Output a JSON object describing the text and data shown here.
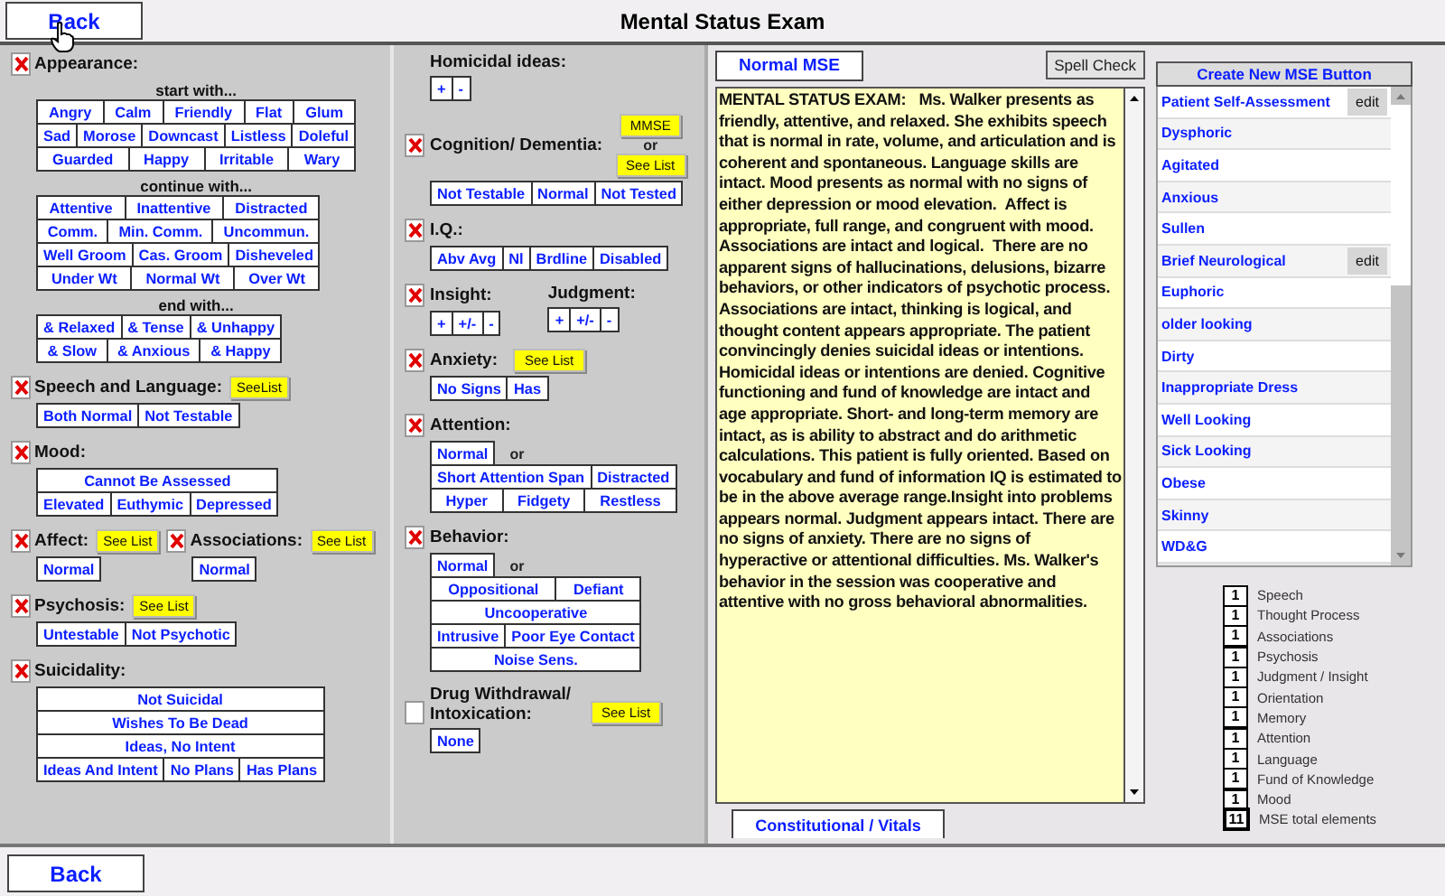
{
  "header": {
    "back": "Back",
    "title": "Mental Status Exam"
  },
  "columns": [
    {
      "sections": [
        {
          "parts": [
            {
              "label": "Appearance:",
              "checked": true,
              "groups": [
                {
                  "caption": "start with...",
                  "rows": [
                    {
                      "buttons": [
                        "Angry",
                        "Calm",
                        "Friendly",
                        "Flat",
                        "Glum"
                      ]
                    },
                    {
                      "buttons": [
                        "Sad",
                        "Morose",
                        "Downcast",
                        "Listless",
                        "Doleful"
                      ]
                    },
                    {
                      "buttons": [
                        "Guarded",
                        "Happy",
                        "Irritable",
                        "Wary"
                      ]
                    }
                  ]
                },
                {
                  "caption": "continue with...",
                  "rows": [
                    {
                      "buttons": [
                        "Attentive",
                        "Inattentive",
                        "Distracted"
                      ]
                    },
                    {
                      "buttons": [
                        "Comm.",
                        "Min. Comm.",
                        "Uncommun."
                      ]
                    },
                    {
                      "buttons": [
                        "Well Groom",
                        "Cas. Groom",
                        "Disheveled"
                      ]
                    },
                    {
                      "buttons": [
                        "Under Wt",
                        "Normal Wt",
                        "Over Wt"
                      ]
                    }
                  ]
                },
                {
                  "caption": "end with...",
                  "rows": [
                    {
                      "buttons": [
                        "& Relaxed",
                        "& Tense",
                        "& Unhappy"
                      ]
                    },
                    {
                      "buttons": [
                        "& Slow",
                        "& Anxious",
                        "& Happy"
                      ]
                    }
                  ]
                }
              ]
            }
          ]
        },
        {
          "parts": [
            {
              "label": "Speech and Language:",
              "checked": true,
              "see_list": "SeeList",
              "groups": [
                {
                  "rows": [
                    {
                      "buttons": [
                        "Both Normal",
                        "Not Testable"
                      ]
                    }
                  ]
                }
              ]
            }
          ]
        },
        {
          "parts": [
            {
              "label": "Mood:",
              "checked": true,
              "groups": [
                {
                  "rows": [
                    {
                      "buttons": [
                        "Cannot Be Assessed"
                      ]
                    },
                    {
                      "buttons": [
                        "Elevated",
                        "Euthymic",
                        "Depressed"
                      ]
                    }
                  ]
                }
              ]
            }
          ]
        },
        {
          "parts": [
            {
              "label": "Affect:",
              "checked": true,
              "see_list": "See List",
              "groups": [
                {
                  "rows": [
                    {
                      "buttons": [
                        "Normal"
                      ]
                    }
                  ]
                }
              ]
            },
            {
              "label": "Associations:",
              "checked": true,
              "see_list": "See List",
              "groups": [
                {
                  "rows": [
                    {
                      "buttons": [
                        "Normal"
                      ]
                    }
                  ]
                }
              ]
            }
          ]
        },
        {
          "parts": [
            {
              "label": "Psychosis:",
              "checked": true,
              "see_list": "See List",
              "groups": [
                {
                  "rows": [
                    {
                      "buttons": [
                        "Untestable",
                        "Not Psychotic"
                      ]
                    }
                  ]
                }
              ]
            }
          ]
        },
        {
          "parts": [
            {
              "label": "Suicidality:",
              "checked": true,
              "groups": [
                {
                  "rows": [
                    {
                      "buttons": [
                        "Not Suicidal"
                      ]
                    },
                    {
                      "buttons": [
                        "Wishes To Be Dead"
                      ]
                    },
                    {
                      "buttons": [
                        "Ideas, No Intent"
                      ]
                    },
                    {
                      "buttons": [
                        "Ideas And Intent",
                        "No Plans",
                        "Has Plans"
                      ]
                    }
                  ]
                }
              ]
            }
          ]
        }
      ]
    },
    {
      "sections": [
        {
          "parts": [
            {
              "label": "Homicidal ideas:",
              "groups": [
                {
                  "rows": [
                    {
                      "buttons": [
                        "+",
                        "-"
                      ]
                    }
                  ]
                }
              ]
            }
          ]
        },
        {
          "parts": [
            {
              "label": "Cognition/ Dementia:",
              "checked": true,
              "alt_button": "MMSE",
              "alt_note": "or",
              "see_list": "See List",
              "groups": [
                {
                  "rows": [
                    {
                      "buttons": [
                        "Not Testable",
                        "Normal",
                        "Not Tested"
                      ]
                    }
                  ]
                }
              ]
            }
          ]
        },
        {
          "parts": [
            {
              "label": "I.Q.:",
              "checked": true,
              "groups": [
                {
                  "rows": [
                    {
                      "buttons": [
                        "Abv Avg",
                        "Nl",
                        "Brdline",
                        "Disabled"
                      ]
                    }
                  ]
                }
              ]
            }
          ]
        },
        {
          "parts": [
            {
              "label": "Insight:",
              "checked": true,
              "groups": [
                {
                  "rows": [
                    {
                      "buttons": [
                        "+",
                        "+/-",
                        "-"
                      ]
                    }
                  ]
                }
              ]
            },
            {
              "label": "Judgment:",
              "groups": [
                {
                  "rows": [
                    {
                      "buttons": [
                        "+",
                        "+/-",
                        "-"
                      ]
                    }
                  ]
                }
              ]
            }
          ]
        },
        {
          "parts": [
            {
              "label": "Anxiety:",
              "checked": true,
              "see_list": "See List",
              "groups": [
                {
                  "rows": [
                    {
                      "buttons": [
                        "No Signs",
                        "Has"
                      ]
                    }
                  ]
                }
              ]
            }
          ]
        },
        {
          "parts": [
            {
              "label": "Attention:",
              "checked": true,
              "groups": [
                {
                  "lead": "Normal",
                  "lead_note": "or",
                  "rows": [
                    {
                      "buttons": [
                        "Short Attention Span",
                        "Distracted"
                      ]
                    },
                    {
                      "buttons": [
                        "Hyper",
                        "Fidgety",
                        "Restless"
                      ]
                    }
                  ]
                }
              ]
            }
          ]
        },
        {
          "parts": [
            {
              "label": "Behavior:",
              "checked": true,
              "groups": [
                {
                  "lead": "Normal",
                  "lead_note": "or",
                  "rows": [
                    {
                      "buttons": [
                        "Oppositional",
                        "Defiant"
                      ]
                    },
                    {
                      "buttons": [
                        "Uncooperative"
                      ]
                    },
                    {
                      "buttons": [
                        "Intrusive",
                        "Poor Eye Contact"
                      ]
                    },
                    {
                      "buttons": [
                        "Noise Sens."
                      ]
                    }
                  ]
                }
              ]
            }
          ]
        },
        {
          "parts": [
            {
              "label": "Drug Withdrawal/ Intoxication:",
              "checked": false,
              "see_list": "See List",
              "groups": [
                {
                  "rows": [
                    {
                      "buttons": [
                        "None"
                      ]
                    }
                  ]
                }
              ]
            }
          ]
        }
      ]
    }
  ],
  "text_panel": {
    "tab": "Normal MSE",
    "spell_check": "Spell Check",
    "text": "MENTAL STATUS EXAM:   Ms. Walker presents as friendly, attentive, and relaxed. She exhibits speech that is normal in rate, volume, and articulation and is coherent and spontaneous. Language skills are intact. Mood presents as normal with no signs of either depression or mood elevation.  Affect is appropriate, full range, and congruent with mood. Associations are intact and logical.  There are no apparent signs of hallucinations, delusions, bizarre behaviors, or other indicators of psychotic process. Associations are intact, thinking is logical, and thought content appears appropriate. The patient convincingly denies suicidal ideas or intentions. Homicidal ideas or intentions are denied. Cognitive functioning and fund of knowledge are intact and age appropriate. Short- and long-term memory are intact, as is ability to abstract and do arithmetic calculations. This patient is fully oriented. Based on vocabulary and fund of information IQ is estimated to be in the above average range.Insight into problems appears normal. Judgment appears intact. There are no signs of anxiety. There are no signs of hyperactive or attentional difficulties. Ms. Walker's behavior in the session was cooperative and attentive with no gross behavioral abnormalities.",
    "bottom_tab": "Constitutional / Vitals"
  },
  "buttons_panel": {
    "create_button": "Create New MSE Button",
    "items": [
      {
        "label": "Patient Self-Assessment",
        "edit": "edit"
      },
      {
        "label": "Dysphoric"
      },
      {
        "label": "Agitated"
      },
      {
        "label": "Anxious"
      },
      {
        "label": "Sullen"
      },
      {
        "label": "Brief Neurological",
        "edit": "edit"
      },
      {
        "label": "Euphoric"
      },
      {
        "label": "older looking"
      },
      {
        "label": "Dirty"
      },
      {
        "label": "Inappropriate Dress"
      },
      {
        "label": "Well Looking"
      },
      {
        "label": "Sick Looking"
      },
      {
        "label": "Obese"
      },
      {
        "label": "Skinny"
      },
      {
        "label": "WD&G"
      }
    ]
  },
  "counts": [
    {
      "count": "1",
      "label": "Speech"
    },
    {
      "count": "1",
      "label": "Thought Process"
    },
    {
      "count": "1",
      "label": "Associations"
    },
    {
      "count": "1",
      "label": "Psychosis"
    },
    {
      "count": "1",
      "label": "Judgment / Insight"
    },
    {
      "count": "1",
      "label": "Orientation"
    },
    {
      "count": "1",
      "label": "Memory"
    },
    {
      "count": "1",
      "label": "Attention"
    },
    {
      "count": "1",
      "label": "Language"
    },
    {
      "count": "1",
      "label": "Fund of Knowledge"
    },
    {
      "count": "1",
      "label": "Mood"
    }
  ],
  "total": {
    "count": "11",
    "label": "MSE total elements"
  },
  "footer": {
    "back": "Back"
  }
}
